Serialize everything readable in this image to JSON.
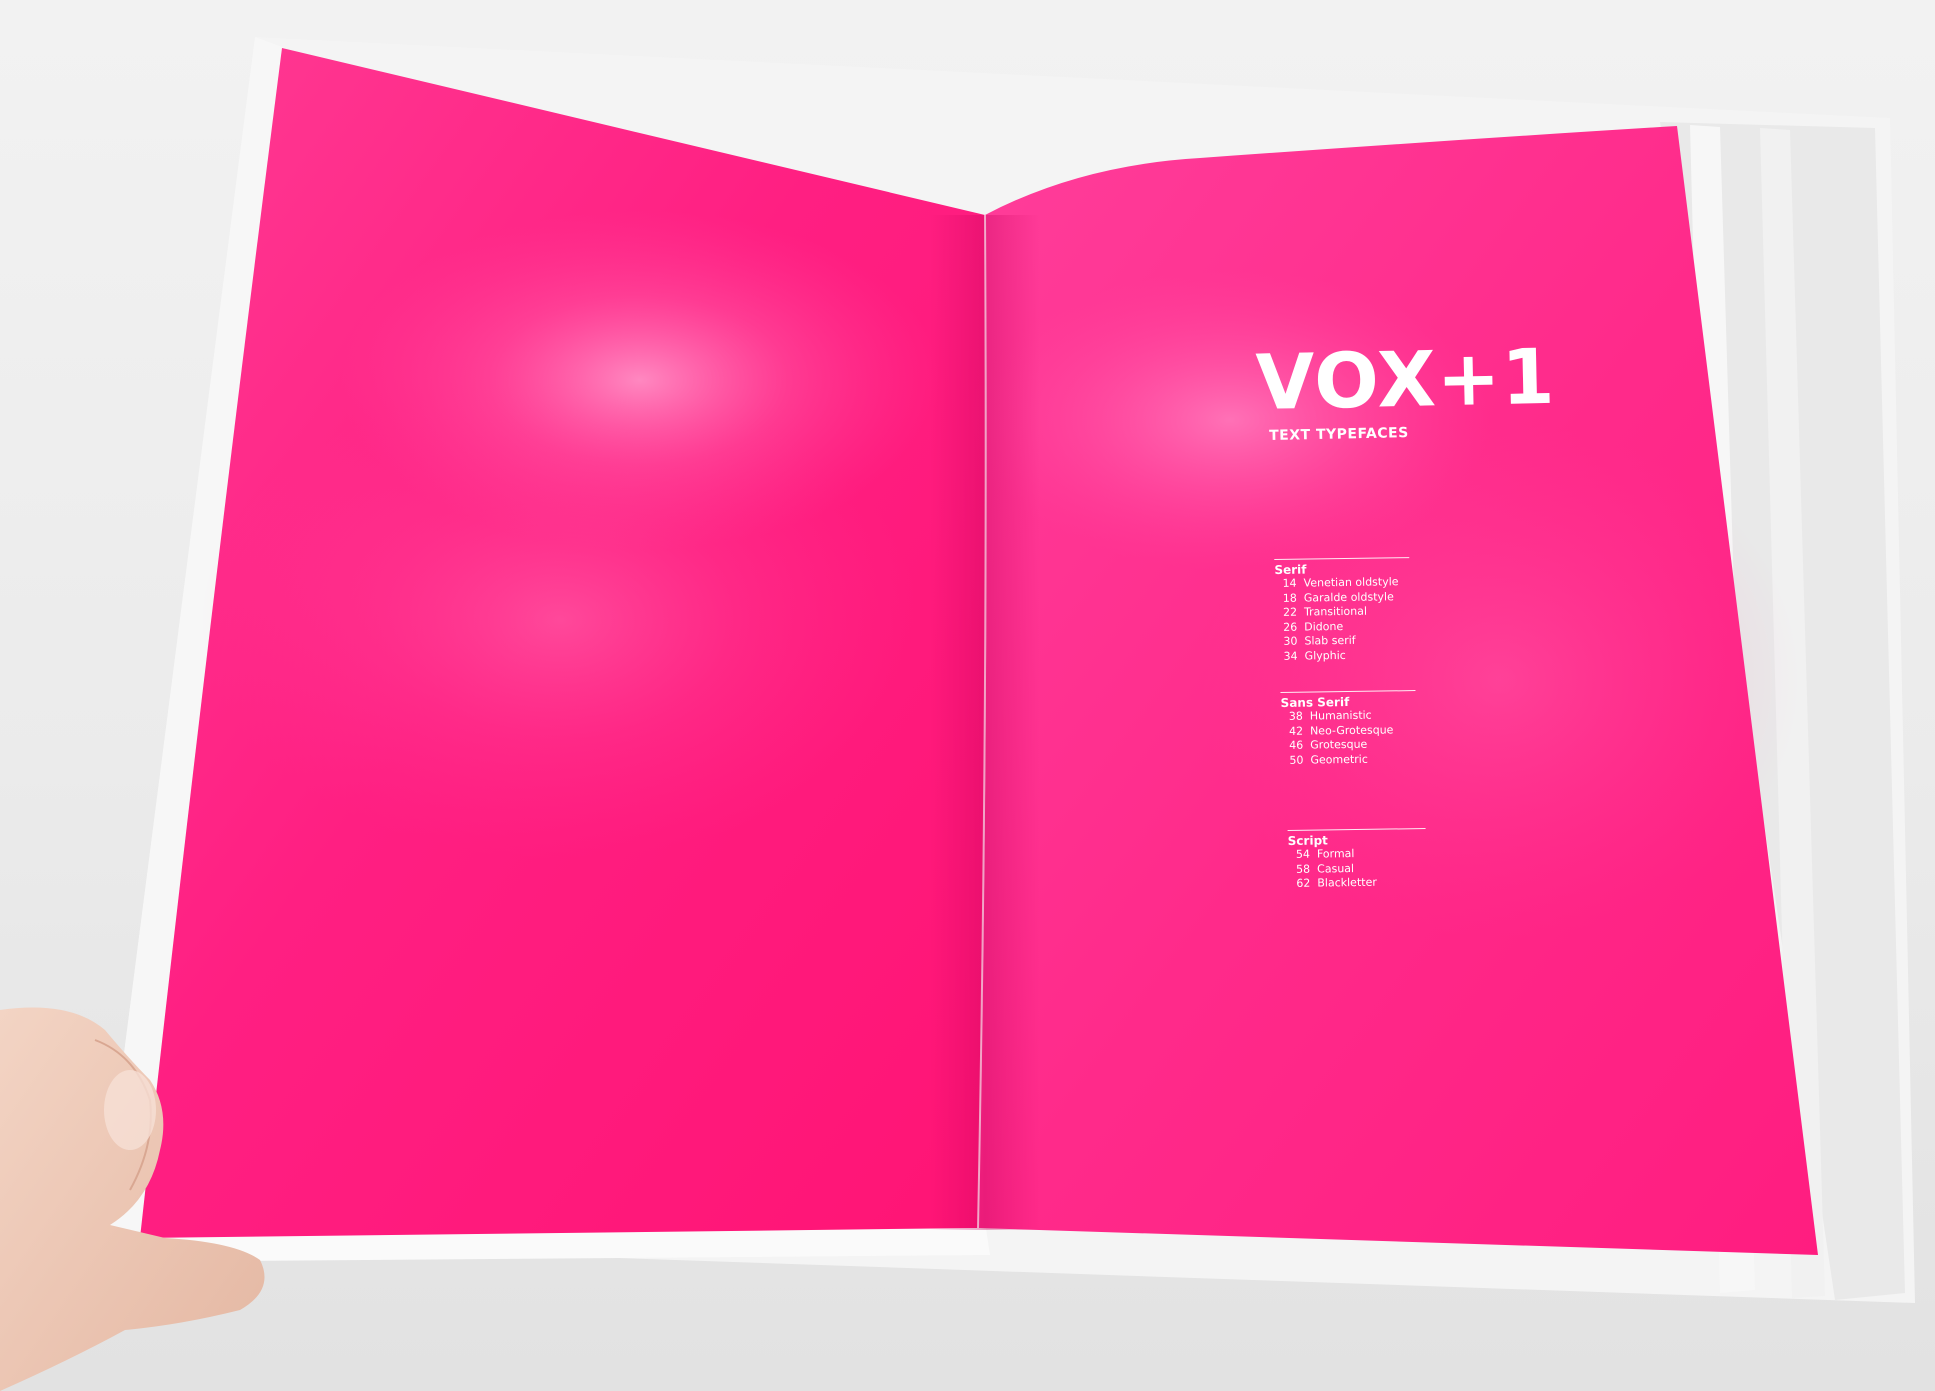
{
  "book": {
    "title": "VOX+1",
    "subtitle": "TEXT TYPEFACES",
    "page_color": "#ff1c7d",
    "sections": [
      {
        "title": "Serif",
        "entries": [
          {
            "page": "14",
            "label": "Venetian oldstyle"
          },
          {
            "page": "18",
            "label": "Garalde oldstyle"
          },
          {
            "page": "22",
            "label": "Transitional"
          },
          {
            "page": "26",
            "label": "Didone"
          },
          {
            "page": "30",
            "label": "Slab serif"
          },
          {
            "page": "34",
            "label": "Glyphic"
          }
        ]
      },
      {
        "title": "Sans Serif",
        "entries": [
          {
            "page": "38",
            "label": "Humanistic"
          },
          {
            "page": "42",
            "label": "Neo-Grotesque"
          },
          {
            "page": "46",
            "label": "Grotesque"
          },
          {
            "page": "50",
            "label": "Geometric"
          }
        ]
      },
      {
        "title": "Script",
        "entries": [
          {
            "page": "54",
            "label": "Formal"
          },
          {
            "page": "58",
            "label": "Casual"
          },
          {
            "page": "62",
            "label": "Blackletter"
          }
        ]
      }
    ]
  }
}
